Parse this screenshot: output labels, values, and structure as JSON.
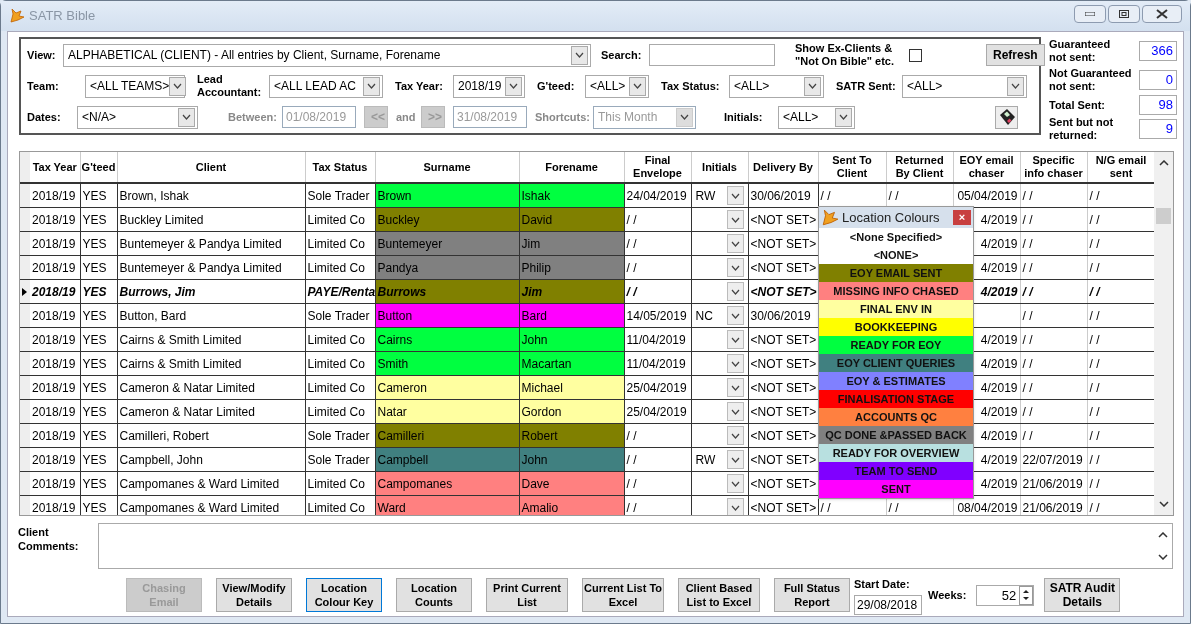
{
  "window": {
    "title": "SATR Bible"
  },
  "filter_rows": [
    [
      {
        "kind": "label",
        "text": "View:"
      },
      {
        "kind": "dropdown",
        "value": "ALPHABETICAL (CLIENT) - All entries by Client, Surname, Forename"
      },
      {
        "kind": "label",
        "text": "Search:"
      },
      {
        "kind": "input"
      },
      {
        "kind": "label",
        "text": "Show Ex-Clients & \"Not On Bible\" etc."
      },
      {
        "kind": "checkbox",
        "checked": false
      },
      {
        "kind": "button",
        "text": "Refresh"
      }
    ],
    [
      {
        "kind": "label",
        "text": "Team:"
      },
      {
        "kind": "dropdown",
        "value": "<ALL TEAMS>"
      },
      {
        "kind": "label",
        "text": "Lead Accountant:"
      },
      {
        "kind": "dropdown",
        "value": "<ALL LEAD AC"
      },
      {
        "kind": "label",
        "text": "Tax Year:"
      },
      {
        "kind": "dropdown",
        "value": "2018/19"
      },
      {
        "kind": "label",
        "text": "G'teed:"
      },
      {
        "kind": "dropdown",
        "value": "<ALL>"
      },
      {
        "kind": "label",
        "text": "Tax Status:"
      },
      {
        "kind": "dropdown",
        "value": "<ALL>"
      },
      {
        "kind": "label",
        "text": "SATR Sent:"
      },
      {
        "kind": "dropdown",
        "value": "<ALL>"
      }
    ],
    [
      {
        "kind": "label",
        "text": "Dates:"
      },
      {
        "kind": "dropdown",
        "value": "<N/A>"
      },
      {
        "kind": "label",
        "text": "Between:",
        "disabled": true
      },
      {
        "kind": "input",
        "value": "01/08/2019",
        "disabled": true
      },
      {
        "kind": "button",
        "text": "<<",
        "disabled": true
      },
      {
        "kind": "label",
        "text": "and",
        "disabled": true
      },
      {
        "kind": "button",
        "text": ">>",
        "disabled": true
      },
      {
        "kind": "input",
        "value": "31/08/2019",
        "disabled": true
      },
      {
        "kind": "label",
        "text": "Shortcuts:",
        "disabled": true
      },
      {
        "kind": "dropdown",
        "value": "This Month",
        "disabled": true
      },
      {
        "kind": "label",
        "text": "Initials:"
      },
      {
        "kind": "dropdown",
        "value": "<ALL>"
      },
      {
        "kind": "save"
      }
    ]
  ],
  "stats": [
    {
      "label": "Guaranteed\nnot sent:",
      "value": "366"
    },
    {
      "label": "Not Guaranteed\nnot sent:",
      "value": "0"
    },
    {
      "label": "Total Sent:",
      "value": "98"
    },
    {
      "label": "Sent but not\nreturned:",
      "value": "9"
    }
  ],
  "table": {
    "columns": [
      "Tax Year",
      "G'teed",
      "Client",
      "Tax Status",
      "Surname",
      "Forename",
      "Final Envelope",
      "Initials",
      "Delivery By",
      "Sent To Client",
      "Returned By Client",
      "EOY email chaser",
      "Specific info chaser",
      "N/G email sent"
    ],
    "rows": [
      {
        "selected": false,
        "color": "#00ff40",
        "cells": [
          "2018/19",
          "YES",
          "Brown, Ishak",
          "Sole Trader",
          "Brown",
          "Ishak",
          "24/04/2019",
          "RW",
          "30/06/2019",
          "/ /",
          "/ /",
          "05/04/2019",
          "/ /",
          "/ /"
        ]
      },
      {
        "selected": false,
        "color": "#808000",
        "cells": [
          "2018/19",
          "YES",
          "Buckley Limited",
          "Limited Co",
          "Buckley",
          "David",
          "/ /",
          "",
          "<NOT SET>",
          "",
          "",
          "4/2019",
          "/ /",
          "/ /"
        ]
      },
      {
        "selected": false,
        "color": "#808080",
        "cells": [
          "2018/19",
          "YES",
          "Buntemeyer & Pandya Limited",
          "Limited Co",
          "Buntemeyer",
          "Jim",
          "/ /",
          "",
          "<NOT SET>",
          "",
          "",
          "4/2019",
          "/ /",
          "/ /"
        ]
      },
      {
        "selected": false,
        "color": "#808080",
        "cells": [
          "2018/19",
          "YES",
          "Buntemeyer & Pandya Limited",
          "Limited Co",
          "Pandya",
          "Philip",
          "/ /",
          "",
          "<NOT SET>",
          "",
          "",
          "4/2019",
          "/ /",
          "/ /"
        ]
      },
      {
        "selected": true,
        "color": "#808000",
        "cells": [
          "2018/19",
          "YES",
          "Burrows, Jim",
          "PAYE/Renta",
          "Burrows",
          "Jim",
          "/ /",
          "",
          "<NOT SET>",
          "",
          "",
          "4/2019",
          "/ /",
          "/ /"
        ]
      },
      {
        "selected": false,
        "color": "#ff00ff",
        "cells": [
          "2018/19",
          "YES",
          "Button, Bard",
          "Sole Trader",
          "Button",
          "Bard",
          "14/05/2019",
          "NC",
          "30/06/2019",
          "",
          "",
          "",
          "/ /",
          "/ /"
        ]
      },
      {
        "selected": false,
        "color": "#00ff40",
        "cells": [
          "2018/19",
          "YES",
          "Cairns & Smith Limited",
          "Limited Co",
          "Cairns",
          "John",
          "11/04/2019",
          "",
          "<NOT SET>",
          "",
          "",
          "4/2019",
          "/ /",
          "/ /"
        ]
      },
      {
        "selected": false,
        "color": "#00ff40",
        "cells": [
          "2018/19",
          "YES",
          "Cairns & Smith Limited",
          "Limited Co",
          "Smith",
          "Macartan",
          "11/04/2019",
          "",
          "<NOT SET>",
          "",
          "",
          "4/2019",
          "/ /",
          "/ /"
        ]
      },
      {
        "selected": false,
        "color": "#ffffa0",
        "cells": [
          "2018/19",
          "YES",
          "Cameron & Natar Limited",
          "Limited Co",
          "Cameron",
          "Michael",
          "25/04/2019",
          "",
          "<NOT SET>",
          "",
          "",
          "4/2019",
          "/ /",
          "/ /"
        ]
      },
      {
        "selected": false,
        "color": "#ffffa0",
        "cells": [
          "2018/19",
          "YES",
          "Cameron & Natar Limited",
          "Limited Co",
          "Natar",
          "Gordon",
          "25/04/2019",
          "",
          "<NOT SET>",
          "",
          "",
          "4/2019",
          "/ /",
          "/ /"
        ]
      },
      {
        "selected": false,
        "color": "#808000",
        "cells": [
          "2018/19",
          "YES",
          "Camilleri, Robert",
          "Sole Trader",
          "Camilleri",
          "Robert",
          "/ /",
          "",
          "<NOT SET>",
          "",
          "",
          "4/2019",
          "/ /",
          "/ /"
        ]
      },
      {
        "selected": false,
        "color": "#408080",
        "cells": [
          "2018/19",
          "YES",
          "Campbell, John",
          "Sole Trader",
          "Campbell",
          "John",
          "/ /",
          "RW",
          "<NOT SET>",
          "",
          "",
          "4/2019",
          "22/07/2019",
          "/ /"
        ]
      },
      {
        "selected": false,
        "color": "#ff8080",
        "cells": [
          "2018/19",
          "YES",
          "Campomanes & Ward Limited",
          "Limited Co",
          "Campomanes",
          "Dave",
          "/ /",
          "",
          "<NOT SET>",
          "",
          "",
          "4/2019",
          "21/06/2019",
          "/ /"
        ]
      },
      {
        "selected": false,
        "color": "#ff8080",
        "cells": [
          "2018/19",
          "YES",
          "Campomanes & Ward Limited",
          "Limited Co",
          "Ward",
          "Amalio",
          "/ /",
          "",
          "<NOT SET>",
          "/ /",
          "/ /",
          "08/04/2019",
          "21/06/2019",
          "/ /"
        ]
      }
    ]
  },
  "legend": {
    "title": "Location Colours",
    "close": "×",
    "items": [
      {
        "label": "<None Specified>",
        "color": "#ffffff"
      },
      {
        "label": "<NONE>",
        "color": "#ffffff"
      },
      {
        "label": "EOY EMAIL SENT",
        "color": "#808000"
      },
      {
        "label": "MISSING INFO CHASED",
        "color": "#ff8080"
      },
      {
        "label": "FINAL ENV IN",
        "color": "#ffffa0"
      },
      {
        "label": "BOOKKEEPING",
        "color": "#ffff00"
      },
      {
        "label": "READY FOR EOY",
        "color": "#00ff40"
      },
      {
        "label": "EOY CLIENT QUERIES",
        "color": "#408080"
      },
      {
        "label": "EOY & ESTIMATES",
        "color": "#8080ff"
      },
      {
        "label": "FINALISATION STAGE",
        "color": "#ff0000"
      },
      {
        "label": "ACCOUNTS QC",
        "color": "#ff8040"
      },
      {
        "label": "QC DONE &PASSED BACK",
        "color": "#808080"
      },
      {
        "label": "READY FOR OVERVIEW",
        "color": "#b8e0e0"
      },
      {
        "label": "TEAM TO SEND",
        "color": "#8000ff"
      },
      {
        "label": "SENT",
        "color": "#ff00ff"
      }
    ]
  },
  "comments": {
    "label": "Client Comments:"
  },
  "buttons": [
    {
      "label": "Chasing Email",
      "disabled": true,
      "focused": false
    },
    {
      "label": "View/Modify Details",
      "disabled": false,
      "focused": false
    },
    {
      "label": "Location Colour Key",
      "disabled": false,
      "focused": true
    },
    {
      "label": "Location Counts",
      "disabled": false,
      "focused": false
    },
    {
      "label": "Print Current List",
      "disabled": false,
      "focused": false
    },
    {
      "label": "Current List To Excel",
      "disabled": false,
      "focused": false
    },
    {
      "label": "Client Based List to Excel",
      "disabled": false,
      "focused": false
    },
    {
      "label": "Full Status Report",
      "disabled": false,
      "focused": false
    }
  ],
  "start_date": {
    "label": "Start Date:",
    "value": "29/08/2018"
  },
  "weeks": {
    "label": "Weeks:",
    "value": "52"
  },
  "audit_button": {
    "label": "SATR Audit Details"
  }
}
